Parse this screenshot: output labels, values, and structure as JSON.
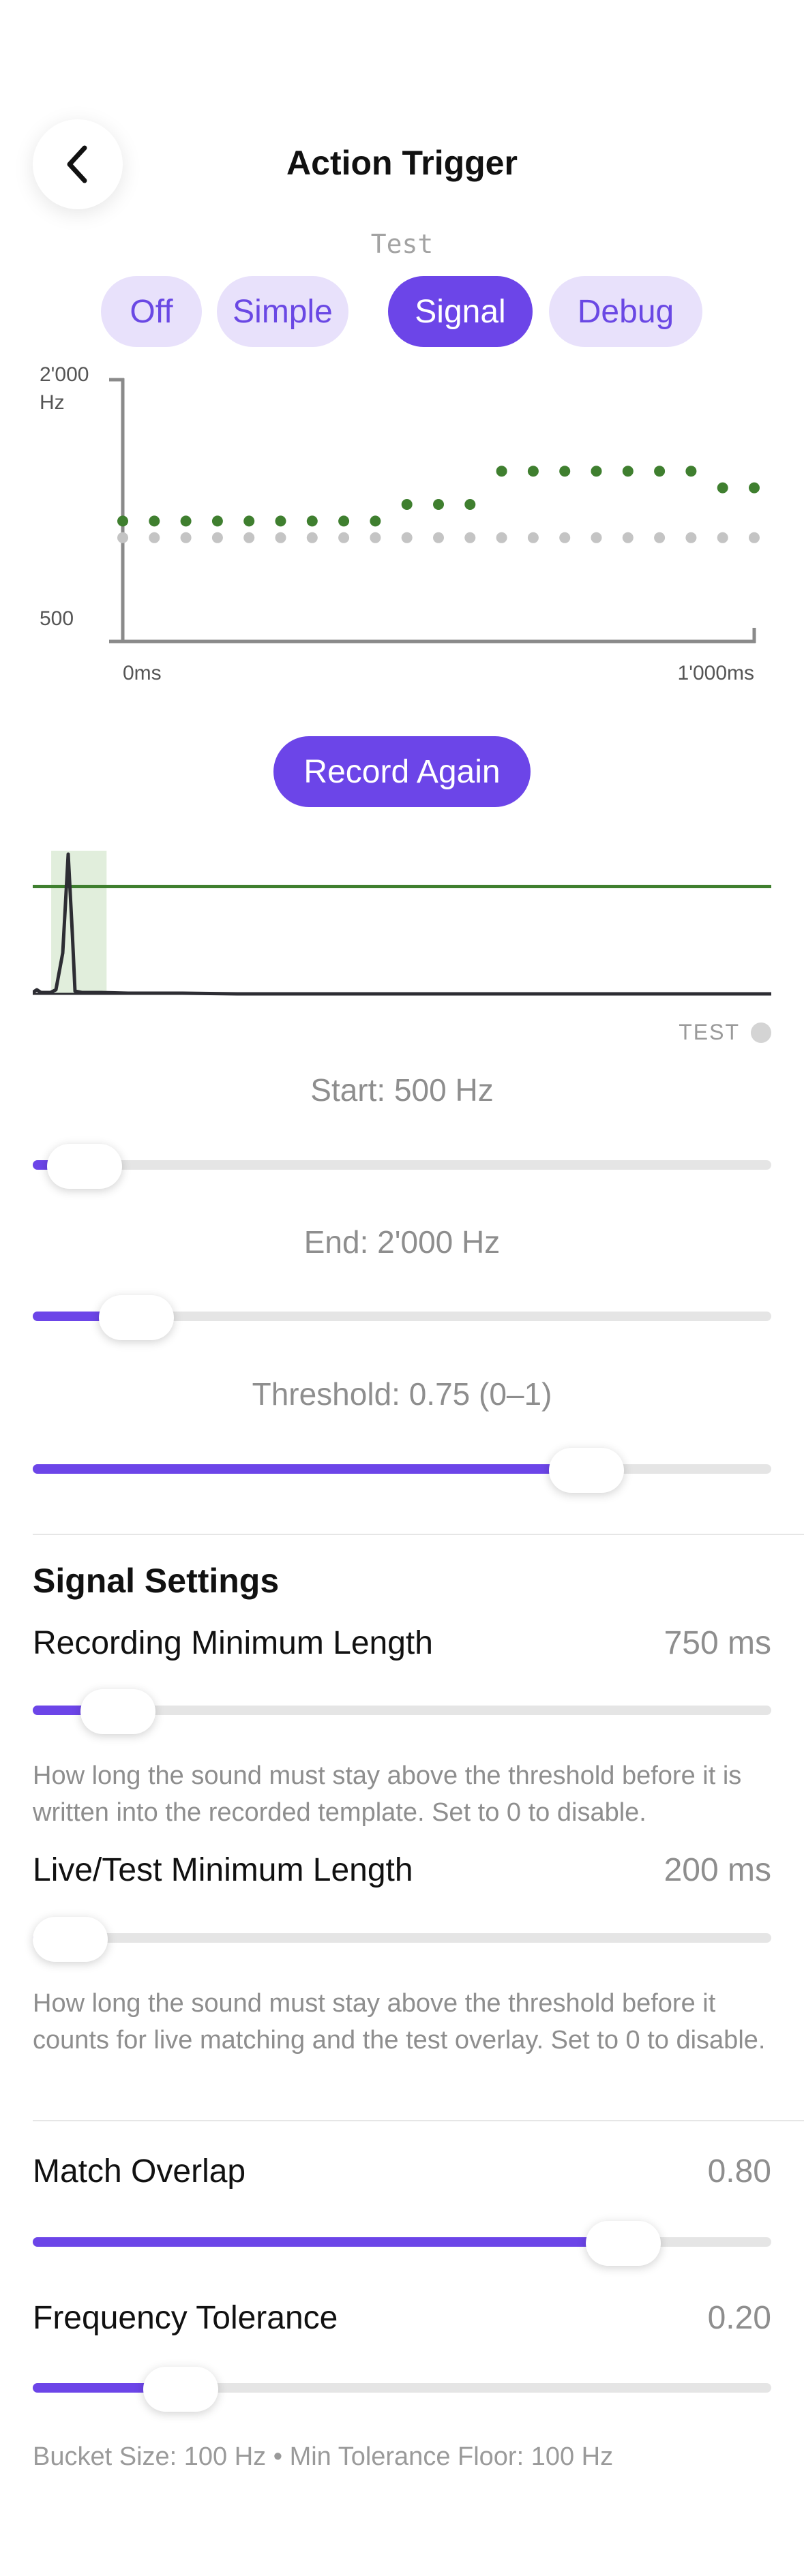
{
  "header": {
    "title": "Action Trigger",
    "back_icon": "chevron-left-icon"
  },
  "mode": {
    "label": "Test",
    "options": [
      "Off",
      "Simple",
      "Signal",
      "Debug"
    ],
    "selected": "Signal"
  },
  "colors": {
    "accent": "#6c45e8",
    "accent_light": "#e8e1fb",
    "signal_green": "#3f7f2f",
    "reference_gray": "#c4c4c4"
  },
  "chart_data": {
    "type": "scatter",
    "y_tick_labels": [
      "2'000",
      "500"
    ],
    "y_unit": "Hz",
    "x_tick_labels": [
      "0ms",
      "1'000ms"
    ],
    "xlim": [
      0,
      1000
    ],
    "ylim": [
      500,
      2000
    ],
    "x": [
      0,
      50,
      100,
      150,
      200,
      250,
      300,
      350,
      400,
      450,
      500,
      550,
      600,
      650,
      700,
      750,
      800,
      850,
      900,
      950,
      1000
    ],
    "series": [
      {
        "color": "#3f7f2f",
        "values": [
          1150,
          1150,
          1150,
          1150,
          1150,
          1150,
          1150,
          1150,
          1150,
          1250,
          1250,
          1250,
          1450,
          1450,
          1450,
          1450,
          1450,
          1450,
          1450,
          1350,
          1350
        ]
      },
      {
        "color": "#c4c4c4",
        "values": [
          1050,
          1050,
          1050,
          1050,
          1050,
          1050,
          1050,
          1050,
          1050,
          1050,
          1050,
          1050,
          1050,
          1050,
          1050,
          1050,
          1050,
          1050,
          1050,
          1050,
          1050
        ]
      }
    ]
  },
  "record_button": {
    "label": "Record Again"
  },
  "waveform": {
    "threshold": 0.75,
    "highlight_range": [
      0.025,
      0.1
    ],
    "line_color": "#3f7f2f",
    "highlight_color": "#e1eedc"
  },
  "test_indicator": {
    "label": "TEST"
  },
  "sliders": {
    "start": {
      "label": "Start: 500 Hz",
      "value": 0.07
    },
    "end": {
      "label": "End: 2'000 Hz",
      "value": 0.14
    },
    "threshold": {
      "label": "Threshold: 0.75 (0–1)",
      "value": 0.75
    }
  },
  "signal_settings": {
    "title": "Signal Settings",
    "recording_min_length": {
      "label": "Recording Minimum Length",
      "value": "750 ms",
      "fraction": 0.115,
      "help": "How long the sound must stay above the threshold before it is written into the recorded template. Set to 0 to disable."
    },
    "live_min_length": {
      "label": "Live/Test Minimum Length",
      "value": "200 ms",
      "fraction": 0.03,
      "help": "How long the sound must stay above the threshold before it counts for live matching and the test overlay. Set to 0 to disable."
    },
    "match_overlap": {
      "label": "Match Overlap",
      "value": "0.80",
      "fraction": 0.8
    },
    "frequency_tolerance": {
      "label": "Frequency Tolerance",
      "value": "0.20",
      "fraction": 0.2
    },
    "footer": "Bucket Size: 100 Hz  •  Min Tolerance Floor: 100 Hz"
  }
}
